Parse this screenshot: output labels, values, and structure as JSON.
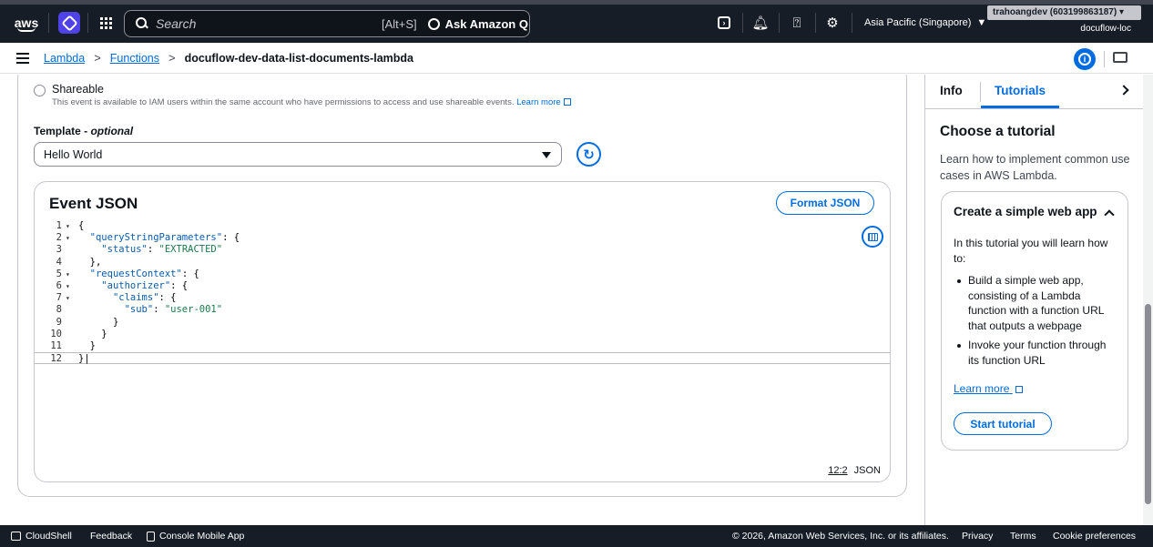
{
  "topbar": {
    "logo": "aws",
    "search_placeholder": "Search",
    "search_shortcut": "[Alt+S]",
    "ask_q_label": "Ask Amazon Q",
    "region_label": "Asia Pacific (Singapore)",
    "account_label": "trahoangdev (603199863187)",
    "account_sub": "docuflow-loc"
  },
  "breadcrumb": {
    "items": [
      "Lambda",
      "Functions"
    ],
    "current": "docuflow-dev-data-list-documents-lambda"
  },
  "main": {
    "shareable_label": "Shareable",
    "shareable_desc": "This event is available to IAM users within the same account who have permissions to access and use shareable events.",
    "learn_more": "Learn more",
    "template_label": "Template - ",
    "template_optional": "optional",
    "template_value": "Hello World",
    "editor": {
      "title": "Event JSON",
      "format_label": "Format JSON",
      "cursor_pos": "12:2",
      "language": "JSON",
      "lines": [
        {
          "n": "1",
          "fold": "▾"
        },
        {
          "n": "2",
          "fold": "▾"
        },
        {
          "n": "3",
          "fold": ""
        },
        {
          "n": "4",
          "fold": ""
        },
        {
          "n": "5",
          "fold": "▾"
        },
        {
          "n": "6",
          "fold": "▾"
        },
        {
          "n": "7",
          "fold": "▾"
        },
        {
          "n": "8",
          "fold": ""
        },
        {
          "n": "9",
          "fold": ""
        },
        {
          "n": "10",
          "fold": ""
        },
        {
          "n": "11",
          "fold": ""
        },
        {
          "n": "12",
          "fold": ""
        }
      ],
      "code": {
        "l1": "{",
        "l2_key": "\"queryStringParameters\"",
        "l2_rest": ": {",
        "l3_key": "\"status\"",
        "l3_val": "\"EXTRACTED\"",
        "l4": "},",
        "l5_key": "\"requestContext\"",
        "l5_rest": ": {",
        "l6_key": "\"authorizer\"",
        "l6_rest": ": {",
        "l7_key": "\"claims\"",
        "l7_rest": ": {",
        "l8_key": "\"sub\"",
        "l8_val": "\"user-001\"",
        "l9": "}",
        "l10": "}",
        "l11": "}",
        "l12": "}"
      }
    }
  },
  "panel": {
    "tab_info": "Info",
    "tab_tutorials": "Tutorials",
    "heading": "Choose a tutorial",
    "intro": "Learn how to implement common use cases in AWS Lambda.",
    "tutorial": {
      "title": "Create a simple web app",
      "intro": "In this tutorial you will learn how to:",
      "bullets": [
        "Build a simple web app, consisting of a Lambda function with a function URL that outputs a webpage",
        "Invoke your function through its function URL"
      ],
      "learn_more": "Learn more",
      "start_label": "Start tutorial"
    }
  },
  "footer": {
    "cloudshell": "CloudShell",
    "feedback": "Feedback",
    "mobile_app": "Console Mobile App",
    "copyright": "© 2026, Amazon Web Services, Inc. or its affiliates.",
    "privacy": "Privacy",
    "terms": "Terms",
    "cookie": "Cookie preferences"
  },
  "colors": {
    "nav_bg": "#161d26",
    "link_blue": "#006ce0",
    "q_purple": "#4e42e8"
  }
}
